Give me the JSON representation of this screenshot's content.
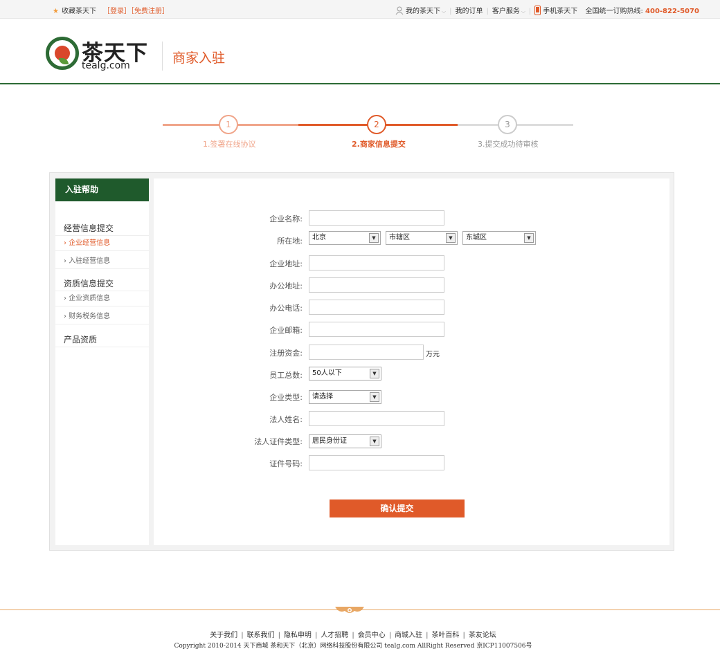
{
  "topbar": {
    "favorite": "收藏茶天下",
    "login": "［登录］",
    "register": "［免费注册］",
    "my_account": "我的茶天下",
    "my_orders": "我的订单",
    "customer_service": "客户服务",
    "mobile": "手机茶天下",
    "hotline_label": "全国统一订购热线:",
    "hotline": "400-822-5070"
  },
  "header": {
    "logo_cn": "茶天下",
    "logo_en": "tealg.com",
    "title": "商家入驻"
  },
  "steps": [
    {
      "num": "1",
      "label": "1.签署在线协议",
      "state": "done"
    },
    {
      "num": "2",
      "label": "2.商家信息提交",
      "state": "active"
    },
    {
      "num": "3",
      "label": "3.提交成功待审核",
      "state": "todo"
    }
  ],
  "sidebar": {
    "title": "入驻帮助",
    "group1": "经营信息提交",
    "item1": "企业经营信息",
    "item2": "入驻经营信息",
    "group2": "资质信息提交",
    "item3": "企业资质信息",
    "item4": "财务税务信息",
    "group3": "产品资质"
  },
  "form": {
    "company_name": "企业名称:",
    "location": "所在地:",
    "province": "北京",
    "city": "市辖区",
    "district": "东城区",
    "company_address": "企业地址:",
    "office_address": "办公地址:",
    "office_phone": "办公电话:",
    "company_email": "企业邮箱:",
    "registered_capital": "注册资金:",
    "capital_unit": "万元",
    "employees": "员工总数:",
    "employees_value": "50人以下",
    "company_type": "企业类型:",
    "company_type_value": "请选择",
    "legal_name": "法人姓名:",
    "id_type": "法人证件类型:",
    "id_type_value": "居民身份证",
    "id_number": "证件号码:",
    "submit": "确认提交"
  },
  "footer": {
    "links": [
      "关于我们",
      "联系我们",
      "隐私申明",
      "人才招聘",
      "会员中心",
      "商城入驻",
      "茶叶百科",
      "茶友论坛"
    ],
    "copyright": "Copyright 2010-2014 天下商城  茶和天下（北京）网络科技股份有限公司 tealg.com   AllRight Reserved 京ICP11007506号"
  },
  "colors": {
    "accent": "#e05a29",
    "brand_green": "#1f5a2c",
    "step_done": "#f0a58a",
    "step_todo": "#cccccc"
  }
}
